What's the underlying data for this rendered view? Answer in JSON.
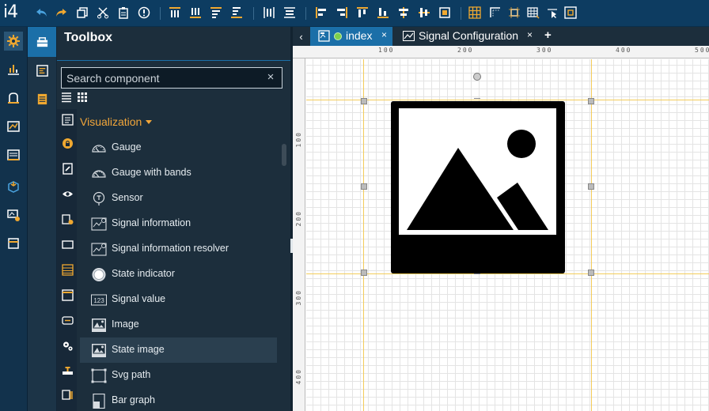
{
  "app": {
    "logo": "i4"
  },
  "toolbox": {
    "title": "Toolbox",
    "search_placeholder": "Search component",
    "clear": "×",
    "category": "Visualization",
    "items": [
      {
        "label": "Gauge",
        "icon": "gauge-icon"
      },
      {
        "label": "Gauge with bands",
        "icon": "gauge-bands-icon"
      },
      {
        "label": "Sensor",
        "icon": "sensor-icon"
      },
      {
        "label": "Signal information",
        "icon": "signal-information-icon"
      },
      {
        "label": "Signal information resolver",
        "icon": "signal-resolver-icon"
      },
      {
        "label": "State indicator",
        "icon": "state-indicator-icon"
      },
      {
        "label": "Signal value",
        "icon": "signal-value-icon",
        "glyph": "123"
      },
      {
        "label": "Image",
        "icon": "image-icon"
      },
      {
        "label": "State image",
        "icon": "state-image-icon"
      },
      {
        "label": "Svg path",
        "icon": "svg-path-icon"
      },
      {
        "label": "Bar graph",
        "icon": "bar-graph-icon"
      }
    ],
    "selected_item": "State image"
  },
  "tabs": [
    {
      "label": "index",
      "close": "×"
    },
    {
      "label": "Signal Configuration",
      "close": "×"
    }
  ],
  "tab_controls": {
    "back": "‹",
    "add": "+"
  },
  "ruler": {
    "horizontal": [
      "100",
      "200",
      "300",
      "400",
      "500"
    ],
    "vertical": [
      "100",
      "200",
      "300",
      "400"
    ]
  },
  "colors": {
    "accent": "#1b6fa8",
    "category": "#f2a63a",
    "toolbar_bg": "#0d3c61",
    "toolbar_icon": "#f0a830"
  }
}
